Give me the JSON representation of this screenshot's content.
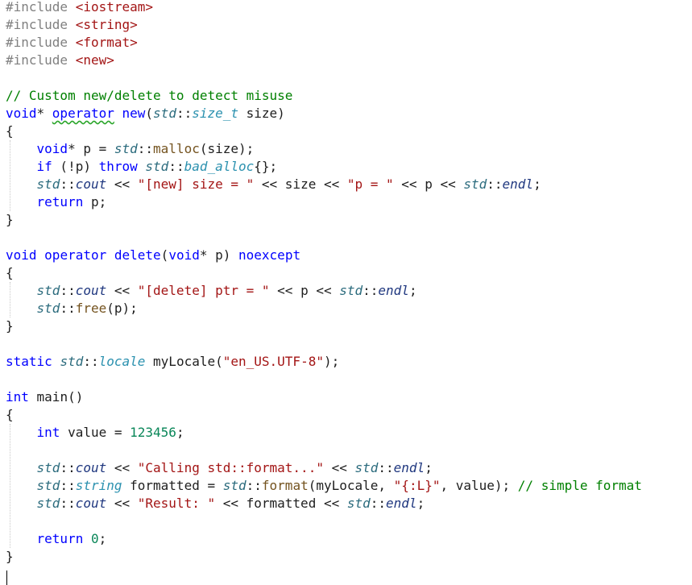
{
  "editor": {
    "lines": [
      [
        {
          "t": "#include ",
          "c": "pre"
        },
        {
          "t": "<iostream>",
          "c": "inc"
        }
      ],
      [
        {
          "t": "#include ",
          "c": "pre"
        },
        {
          "t": "<string>",
          "c": "inc"
        }
      ],
      [
        {
          "t": "#include ",
          "c": "pre"
        },
        {
          "t": "<format>",
          "c": "inc"
        }
      ],
      [
        {
          "t": "#include ",
          "c": "pre"
        },
        {
          "t": "<new>",
          "c": "inc"
        }
      ],
      [],
      [
        {
          "t": "// Custom new/delete to detect misuse",
          "c": "cmt"
        }
      ],
      [
        {
          "t": "void",
          "c": "kw"
        },
        {
          "t": "* ",
          "c": "op"
        },
        {
          "t": "operator",
          "c": "kw",
          "sq": true
        },
        {
          "t": " ",
          "c": "op"
        },
        {
          "t": "new",
          "c": "kw"
        },
        {
          "t": "(",
          "c": "op"
        },
        {
          "t": "std",
          "c": "ns"
        },
        {
          "t": "::",
          "c": "op"
        },
        {
          "t": "size_t",
          "c": "typ"
        },
        {
          "t": " size)",
          "c": "id"
        }
      ],
      [
        {
          "t": "{",
          "c": "op"
        }
      ],
      [
        {
          "t": "    ",
          "c": "op"
        },
        {
          "t": "void",
          "c": "kw"
        },
        {
          "t": "* p = ",
          "c": "id"
        },
        {
          "t": "std",
          "c": "ns"
        },
        {
          "t": "::",
          "c": "op"
        },
        {
          "t": "malloc",
          "c": "fn"
        },
        {
          "t": "(size);",
          "c": "id"
        }
      ],
      [
        {
          "t": "    ",
          "c": "op"
        },
        {
          "t": "if",
          "c": "kw"
        },
        {
          "t": " (!p) ",
          "c": "id"
        },
        {
          "t": "throw",
          "c": "kw"
        },
        {
          "t": " ",
          "c": "op"
        },
        {
          "t": "std",
          "c": "ns"
        },
        {
          "t": "::",
          "c": "op"
        },
        {
          "t": "bad_alloc",
          "c": "typ"
        },
        {
          "t": "{};",
          "c": "id"
        }
      ],
      [
        {
          "t": "    ",
          "c": "op"
        },
        {
          "t": "std",
          "c": "ns"
        },
        {
          "t": "::",
          "c": "op"
        },
        {
          "t": "cout",
          "c": "ital"
        },
        {
          "t": " << ",
          "c": "op"
        },
        {
          "t": "\"[new] size = \"",
          "c": "str"
        },
        {
          "t": " << size << ",
          "c": "id"
        },
        {
          "t": "\"p = \"",
          "c": "str"
        },
        {
          "t": " << p << ",
          "c": "id"
        },
        {
          "t": "std",
          "c": "ns"
        },
        {
          "t": "::",
          "c": "op"
        },
        {
          "t": "endl",
          "c": "ital"
        },
        {
          "t": ";",
          "c": "op"
        }
      ],
      [
        {
          "t": "    ",
          "c": "op"
        },
        {
          "t": "return",
          "c": "kw"
        },
        {
          "t": " p;",
          "c": "id"
        }
      ],
      [
        {
          "t": "}",
          "c": "op"
        }
      ],
      [],
      [
        {
          "t": "void",
          "c": "kw"
        },
        {
          "t": " ",
          "c": "op"
        },
        {
          "t": "operator",
          "c": "kw"
        },
        {
          "t": " ",
          "c": "op"
        },
        {
          "t": "delete",
          "c": "kw"
        },
        {
          "t": "(",
          "c": "op"
        },
        {
          "t": "void",
          "c": "kw"
        },
        {
          "t": "* p) ",
          "c": "id"
        },
        {
          "t": "noexcept",
          "c": "kw"
        }
      ],
      [
        {
          "t": "{",
          "c": "op"
        }
      ],
      [
        {
          "t": "    ",
          "c": "op"
        },
        {
          "t": "std",
          "c": "ns"
        },
        {
          "t": "::",
          "c": "op"
        },
        {
          "t": "cout",
          "c": "ital"
        },
        {
          "t": " << ",
          "c": "op"
        },
        {
          "t": "\"[delete] ptr = \"",
          "c": "str"
        },
        {
          "t": " << p << ",
          "c": "id"
        },
        {
          "t": "std",
          "c": "ns"
        },
        {
          "t": "::",
          "c": "op"
        },
        {
          "t": "endl",
          "c": "ital"
        },
        {
          "t": ";",
          "c": "op"
        }
      ],
      [
        {
          "t": "    ",
          "c": "op"
        },
        {
          "t": "std",
          "c": "ns"
        },
        {
          "t": "::",
          "c": "op"
        },
        {
          "t": "free",
          "c": "fn"
        },
        {
          "t": "(p);",
          "c": "id"
        }
      ],
      [
        {
          "t": "}",
          "c": "op"
        }
      ],
      [],
      [
        {
          "t": "static",
          "c": "kw"
        },
        {
          "t": " ",
          "c": "op"
        },
        {
          "t": "std",
          "c": "ns"
        },
        {
          "t": "::",
          "c": "op"
        },
        {
          "t": "locale",
          "c": "typ"
        },
        {
          "t": " myLocale(",
          "c": "id"
        },
        {
          "t": "\"en_US.UTF-8\"",
          "c": "str"
        },
        {
          "t": ");",
          "c": "op"
        }
      ],
      [],
      [
        {
          "t": "int",
          "c": "kw"
        },
        {
          "t": " main()",
          "c": "id"
        }
      ],
      [
        {
          "t": "{",
          "c": "op"
        }
      ],
      [
        {
          "t": "    ",
          "c": "op"
        },
        {
          "t": "int",
          "c": "kw"
        },
        {
          "t": " value = ",
          "c": "id"
        },
        {
          "t": "123456",
          "c": "num"
        },
        {
          "t": ";",
          "c": "op"
        }
      ],
      [],
      [
        {
          "t": "    ",
          "c": "op"
        },
        {
          "t": "std",
          "c": "ns"
        },
        {
          "t": "::",
          "c": "op"
        },
        {
          "t": "cout",
          "c": "ital"
        },
        {
          "t": " << ",
          "c": "op"
        },
        {
          "t": "\"Calling std::format...\"",
          "c": "str"
        },
        {
          "t": " << ",
          "c": "op"
        },
        {
          "t": "std",
          "c": "ns"
        },
        {
          "t": "::",
          "c": "op"
        },
        {
          "t": "endl",
          "c": "ital"
        },
        {
          "t": ";",
          "c": "op"
        }
      ],
      [
        {
          "t": "    ",
          "c": "op"
        },
        {
          "t": "std",
          "c": "ns"
        },
        {
          "t": "::",
          "c": "op"
        },
        {
          "t": "string",
          "c": "typ"
        },
        {
          "t": " formatted = ",
          "c": "id"
        },
        {
          "t": "std",
          "c": "ns"
        },
        {
          "t": "::",
          "c": "op"
        },
        {
          "t": "format",
          "c": "fn"
        },
        {
          "t": "(myLocale, ",
          "c": "id"
        },
        {
          "t": "\"{:L}\"",
          "c": "str"
        },
        {
          "t": ", value); ",
          "c": "id"
        },
        {
          "t": "// simple format",
          "c": "cmt"
        }
      ],
      [
        {
          "t": "    ",
          "c": "op"
        },
        {
          "t": "std",
          "c": "ns"
        },
        {
          "t": "::",
          "c": "op"
        },
        {
          "t": "cout",
          "c": "ital"
        },
        {
          "t": " << ",
          "c": "op"
        },
        {
          "t": "\"Result: \"",
          "c": "str"
        },
        {
          "t": " << formatted << ",
          "c": "id"
        },
        {
          "t": "std",
          "c": "ns"
        },
        {
          "t": "::",
          "c": "op"
        },
        {
          "t": "endl",
          "c": "ital"
        },
        {
          "t": ";",
          "c": "op"
        }
      ],
      [],
      [
        {
          "t": "    ",
          "c": "op"
        },
        {
          "t": "return",
          "c": "kw"
        },
        {
          "t": " ",
          "c": "op"
        },
        {
          "t": "0",
          "c": "num"
        },
        {
          "t": ";",
          "c": "op"
        }
      ],
      [
        {
          "t": "}",
          "c": "op"
        }
      ]
    ]
  },
  "colors": {
    "preprocessor": "#808080",
    "include": "#a31515",
    "comment": "#008000",
    "keyword": "#0000ff",
    "string": "#a31515",
    "number": "#098658"
  }
}
